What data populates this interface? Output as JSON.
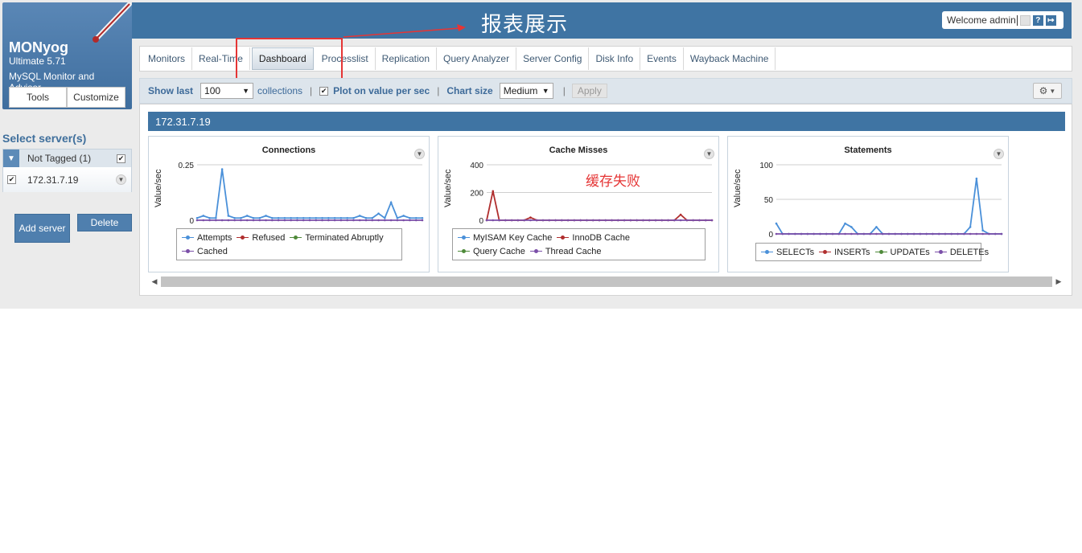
{
  "app": {
    "name": "MONyog",
    "version": "Ultimate 5.71",
    "description": "MySQL Monitor and Advisor",
    "tools_label": "Tools",
    "customize_label": "Customize"
  },
  "header": {
    "welcome": "Welcome admin",
    "help_icon": "?",
    "icons": [
      "note-icon",
      "help-icon",
      "logout-icon"
    ]
  },
  "annotation": {
    "title": "报表展示",
    "cache_note": "缓存失败",
    "color": "#e53535"
  },
  "tabs": [
    {
      "label": "Monitors"
    },
    {
      "label": "Real-Time"
    },
    {
      "label": "Dashboard",
      "active": true
    },
    {
      "label": "Processlist"
    },
    {
      "label": "Replication"
    },
    {
      "label": "Query Analyzer"
    },
    {
      "label": "Server Config"
    },
    {
      "label": "Disk Info"
    },
    {
      "label": "Events"
    },
    {
      "label": "Wayback Machine"
    }
  ],
  "toolbar": {
    "show_last_label": "Show last",
    "show_last_value": "100",
    "collections_label": "collections",
    "plot_per_sec_label": "Plot on value per sec",
    "plot_per_sec_checked": true,
    "chart_size_label": "Chart size",
    "chart_size_value": "Medium",
    "apply_label": "Apply"
  },
  "sidebar": {
    "select_label": "Select server(s)",
    "group_label": "Not Tagged (1)",
    "server": "172.31.7.19",
    "add_label": "Add server",
    "delete_label": "Delete"
  },
  "server_title": "172.31.7.19",
  "colors": {
    "primary": "#3f74a3",
    "series_blue": "#4a90d9",
    "series_red": "#b02e2e",
    "series_green": "#4f8a3a",
    "series_purple": "#7b4fa8"
  },
  "chart_data": [
    {
      "type": "line",
      "title": "Connections",
      "ylabel": "Value/sec",
      "ylim": [
        0,
        0.25
      ],
      "yticks": [
        "0",
        "0.25"
      ],
      "series": [
        {
          "name": "Attempts",
          "color": "#4a90d9",
          "values": [
            0.01,
            0.02,
            0.01,
            0.01,
            0.23,
            0.02,
            0.01,
            0.01,
            0.02,
            0.01,
            0.01,
            0.02,
            0.01,
            0.01,
            0.01,
            0.01,
            0.01,
            0.01,
            0.01,
            0.01,
            0.01,
            0.01,
            0.01,
            0.01,
            0.01,
            0.01,
            0.02,
            0.01,
            0.01,
            0.03,
            0.01,
            0.08,
            0.01,
            0.02,
            0.01,
            0.01,
            0.01
          ]
        },
        {
          "name": "Refused",
          "color": "#b02e2e",
          "values": []
        },
        {
          "name": "Terminated Abruptly",
          "color": "#4f8a3a",
          "values": []
        },
        {
          "name": "Cached",
          "color": "#7b4fa8",
          "values": [
            0,
            0,
            0,
            0,
            0,
            0,
            0,
            0,
            0,
            0,
            0,
            0,
            0,
            0,
            0,
            0,
            0,
            0,
            0,
            0,
            0,
            0,
            0,
            0,
            0,
            0,
            0,
            0,
            0,
            0,
            0,
            0,
            0,
            0,
            0,
            0,
            0
          ]
        }
      ]
    },
    {
      "type": "line",
      "title": "Cache Misses",
      "ylabel": "Value/sec",
      "ylim": [
        0,
        400
      ],
      "yticks": [
        "0",
        "200",
        "400"
      ],
      "series": [
        {
          "name": "MyISAM Key Cache",
          "color": "#4a90d9",
          "values": []
        },
        {
          "name": "InnoDB Cache",
          "color": "#b02e2e",
          "values": [
            0,
            210,
            0,
            0,
            0,
            0,
            0,
            20,
            0,
            0,
            0,
            0,
            0,
            0,
            0,
            0,
            0,
            0,
            0,
            0,
            0,
            0,
            0,
            0,
            0,
            0,
            0,
            0,
            0,
            0,
            0,
            40,
            0,
            0,
            0,
            0,
            0
          ]
        },
        {
          "name": "Query Cache",
          "color": "#4f8a3a",
          "values": []
        },
        {
          "name": "Thread Cache",
          "color": "#7b4fa8",
          "values": [
            0,
            0,
            0,
            0,
            0,
            0,
            0,
            0,
            0,
            0,
            0,
            0,
            0,
            0,
            0,
            0,
            0,
            0,
            0,
            0,
            0,
            0,
            0,
            0,
            0,
            0,
            0,
            0,
            0,
            0,
            0,
            0,
            0,
            0,
            0,
            0,
            0
          ]
        }
      ]
    },
    {
      "type": "line",
      "title": "Statements",
      "ylabel": "Value/sec",
      "ylim": [
        0,
        100
      ],
      "yticks": [
        "0",
        "50",
        "100"
      ],
      "series": [
        {
          "name": "SELECTs",
          "color": "#4a90d9",
          "values": [
            15,
            0,
            0,
            0,
            0,
            0,
            0,
            0,
            0,
            0,
            0,
            15,
            10,
            0,
            0,
            0,
            10,
            0,
            0,
            0,
            0,
            0,
            0,
            0,
            0,
            0,
            0,
            0,
            0,
            0,
            0,
            10,
            80,
            5,
            0,
            0,
            0
          ]
        },
        {
          "name": "INSERTs",
          "color": "#b02e2e",
          "values": []
        },
        {
          "name": "UPDATEs",
          "color": "#4f8a3a",
          "values": []
        },
        {
          "name": "DELETEs",
          "color": "#7b4fa8",
          "values": [
            0,
            0,
            0,
            0,
            0,
            0,
            0,
            0,
            0,
            0,
            0,
            0,
            0,
            0,
            0,
            0,
            0,
            0,
            0,
            0,
            0,
            0,
            0,
            0,
            0,
            0,
            0,
            0,
            0,
            0,
            0,
            0,
            0,
            0,
            0,
            0,
            0
          ]
        }
      ]
    }
  ]
}
